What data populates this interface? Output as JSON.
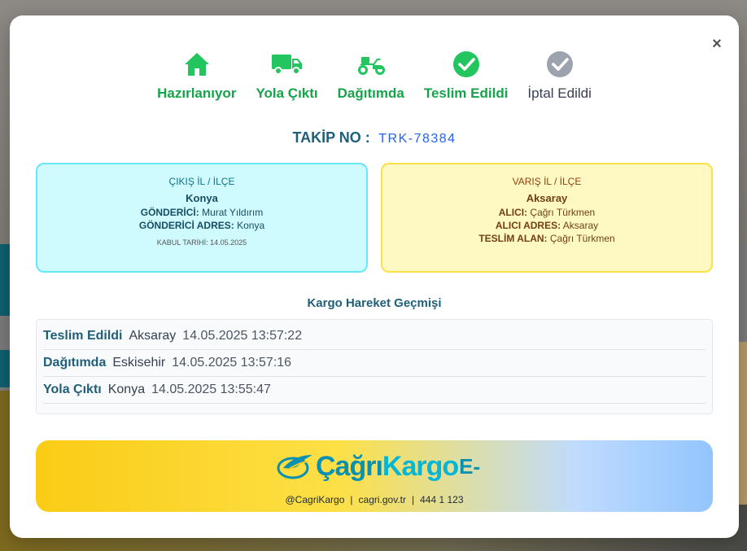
{
  "steps": [
    {
      "label": "Hazırlanıyor",
      "icon": "home-icon"
    },
    {
      "label": "Yola Çıktı",
      "icon": "truck-icon"
    },
    {
      "label": "Dağıtımda",
      "icon": "scooter-icon"
    },
    {
      "label": "Teslim Edildi",
      "icon": "check-circle-icon"
    },
    {
      "label": "İptal Edildi",
      "icon": "check-circle-gray-icon"
    }
  ],
  "colors": {
    "active": "#16a34a",
    "inactive": "#9ca3af",
    "title": "#1e5f7a",
    "tracking_no": "#2563eb"
  },
  "tracking": {
    "label": "TAKİP NO :",
    "number": "TRK-78384"
  },
  "origin": {
    "heading": "ÇIKIŞ İL / İLÇE",
    "city": "Konya",
    "sender_label": "GÖNDERİCİ:",
    "sender": "Murat Yıldırım",
    "sender_address_label": "GÖNDERİCİ ADRES:",
    "sender_address": "Konya",
    "accept_date": "KABUL TARİHİ: 14.05.2025"
  },
  "destination": {
    "heading": "VARIŞ İL / İLÇE",
    "city": "Aksaray",
    "receiver_label": "ALICI:",
    "receiver": "Çağrı Türkmen",
    "receiver_address_label": "ALICI ADRES:",
    "receiver_address": "Aksaray",
    "delivered_to_label": "TESLİM ALAN:",
    "delivered_to": "Çağrı Türkmen"
  },
  "history": {
    "title": "Kargo Hareket Geçmişi",
    "rows": [
      {
        "status": "Teslim Edildi",
        "location": "Aksaray",
        "datetime": "14.05.2025 13:57:22"
      },
      {
        "status": "Dağıtımda",
        "location": "Eskisehir",
        "datetime": "14.05.2025 13:57:16"
      },
      {
        "status": "Yola Çıktı",
        "location": "Konya",
        "datetime": "14.05.2025 13:55:47"
      }
    ]
  },
  "footer": {
    "brand_part1": "Çağrı",
    "brand_part2": "Kargo",
    "brand_suffix": "E-",
    "social": "@CagriKargo",
    "sep1": "|",
    "website": "cagri.gov.tr",
    "sep2": "|",
    "phone": "444 1 123"
  },
  "close_label": "×"
}
